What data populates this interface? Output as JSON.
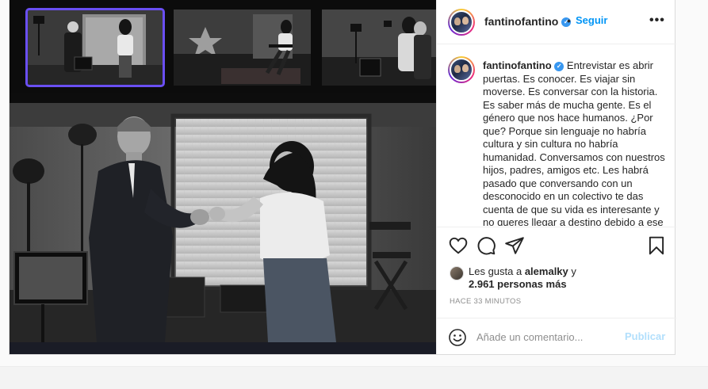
{
  "post": {
    "username": "fantinofantino",
    "verified_glyph": "✓",
    "separator": "•",
    "follow_label": "Seguir",
    "more_label": "•••",
    "caption_text": "Entrevistar es abrir puertas. Es conocer. Es viajar sin moverse. Es conversar con la historia. Es saber más de mucha gente. Es el género que nos hace humanos. ¿Por que? Porque sin lenguaje no habría cultura y sin cultura no habría humanidad. Conversamos con nuestros hijos, padres, amigos etc. Les habrá pasado que conversando con un desconocido en un colectivo te das cuenta de que su vida es interesante y no queres llegar a destino debido a ese",
    "likes_prefix": "Les gusta a ",
    "likes_user": "alemalky",
    "likes_suffix": " y",
    "likes_count": "2.961 personas más",
    "time_ago": "HACE 33 MINUTOS",
    "comment_placeholder": "Añade un comentario...",
    "publish_label": "Publicar"
  },
  "icons": {
    "like": "heart-icon",
    "comment": "comment-icon",
    "share": "share-icon",
    "save": "bookmark-icon",
    "emoji": "emoji-icon",
    "verified": "verified-badge-icon",
    "more": "more-options-icon"
  },
  "colors": {
    "accent": "#0095f6",
    "publish_disabled": "#b2dffc",
    "thumb_selected": "#6a4ff3",
    "verified": "#3897f0"
  }
}
